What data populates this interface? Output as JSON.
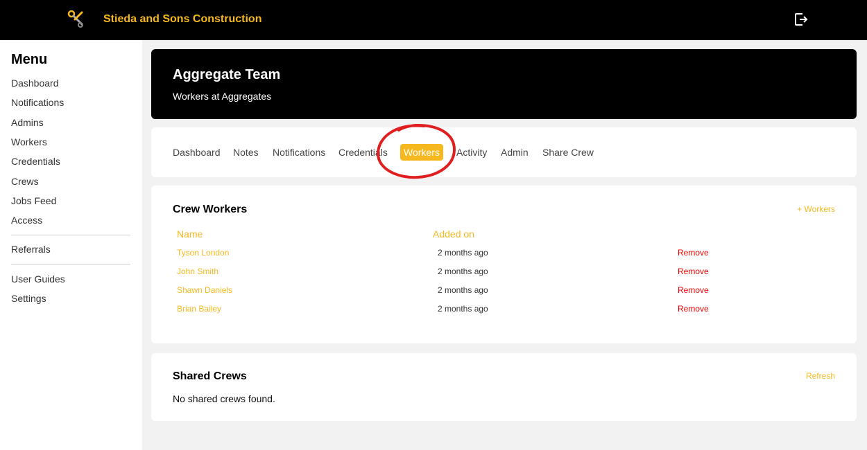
{
  "header": {
    "brand": "Stieda and Sons Construction",
    "logo_icon": "wrench-scissors-icon",
    "logout_icon": "logout-icon",
    "accent": "#f5b91f"
  },
  "sidebar": {
    "title": "Menu",
    "items": [
      {
        "label": "Dashboard"
      },
      {
        "label": "Notifications"
      },
      {
        "label": "Admins"
      },
      {
        "label": "Workers"
      },
      {
        "label": "Credentials"
      },
      {
        "label": "Crews"
      },
      {
        "label": "Jobs Feed"
      },
      {
        "label": "Access"
      },
      {
        "label": "Referrals"
      },
      {
        "label": "User Guides"
      },
      {
        "label": "Settings"
      }
    ]
  },
  "hero": {
    "title": "Aggregate Team",
    "subtitle": "Workers at Aggregates"
  },
  "tabs": {
    "items": [
      {
        "label": "Dashboard"
      },
      {
        "label": "Notes"
      },
      {
        "label": "Notifications"
      },
      {
        "label": "Credentials"
      },
      {
        "label": "Workers",
        "active": true
      },
      {
        "label": "Activity"
      },
      {
        "label": "Admin"
      },
      {
        "label": "Share Crew"
      }
    ],
    "annotation_color": "#e02020"
  },
  "crew_workers": {
    "title": "Crew Workers",
    "add_label": "+ Workers",
    "columns": {
      "name": "Name",
      "added_on": "Added on"
    },
    "rows": [
      {
        "name": "Tyson London",
        "added": "2 months ago",
        "action": "Remove"
      },
      {
        "name": "John Smith",
        "added": "2 months ago",
        "action": "Remove"
      },
      {
        "name": "Shawn Daniels",
        "added": "2 months ago",
        "action": "Remove"
      },
      {
        "name": "Brian Bailey",
        "added": "2 months ago",
        "action": "Remove"
      }
    ]
  },
  "shared_crews": {
    "title": "Shared Crews",
    "refresh_label": "Refresh",
    "empty_text": "No shared crews found."
  }
}
